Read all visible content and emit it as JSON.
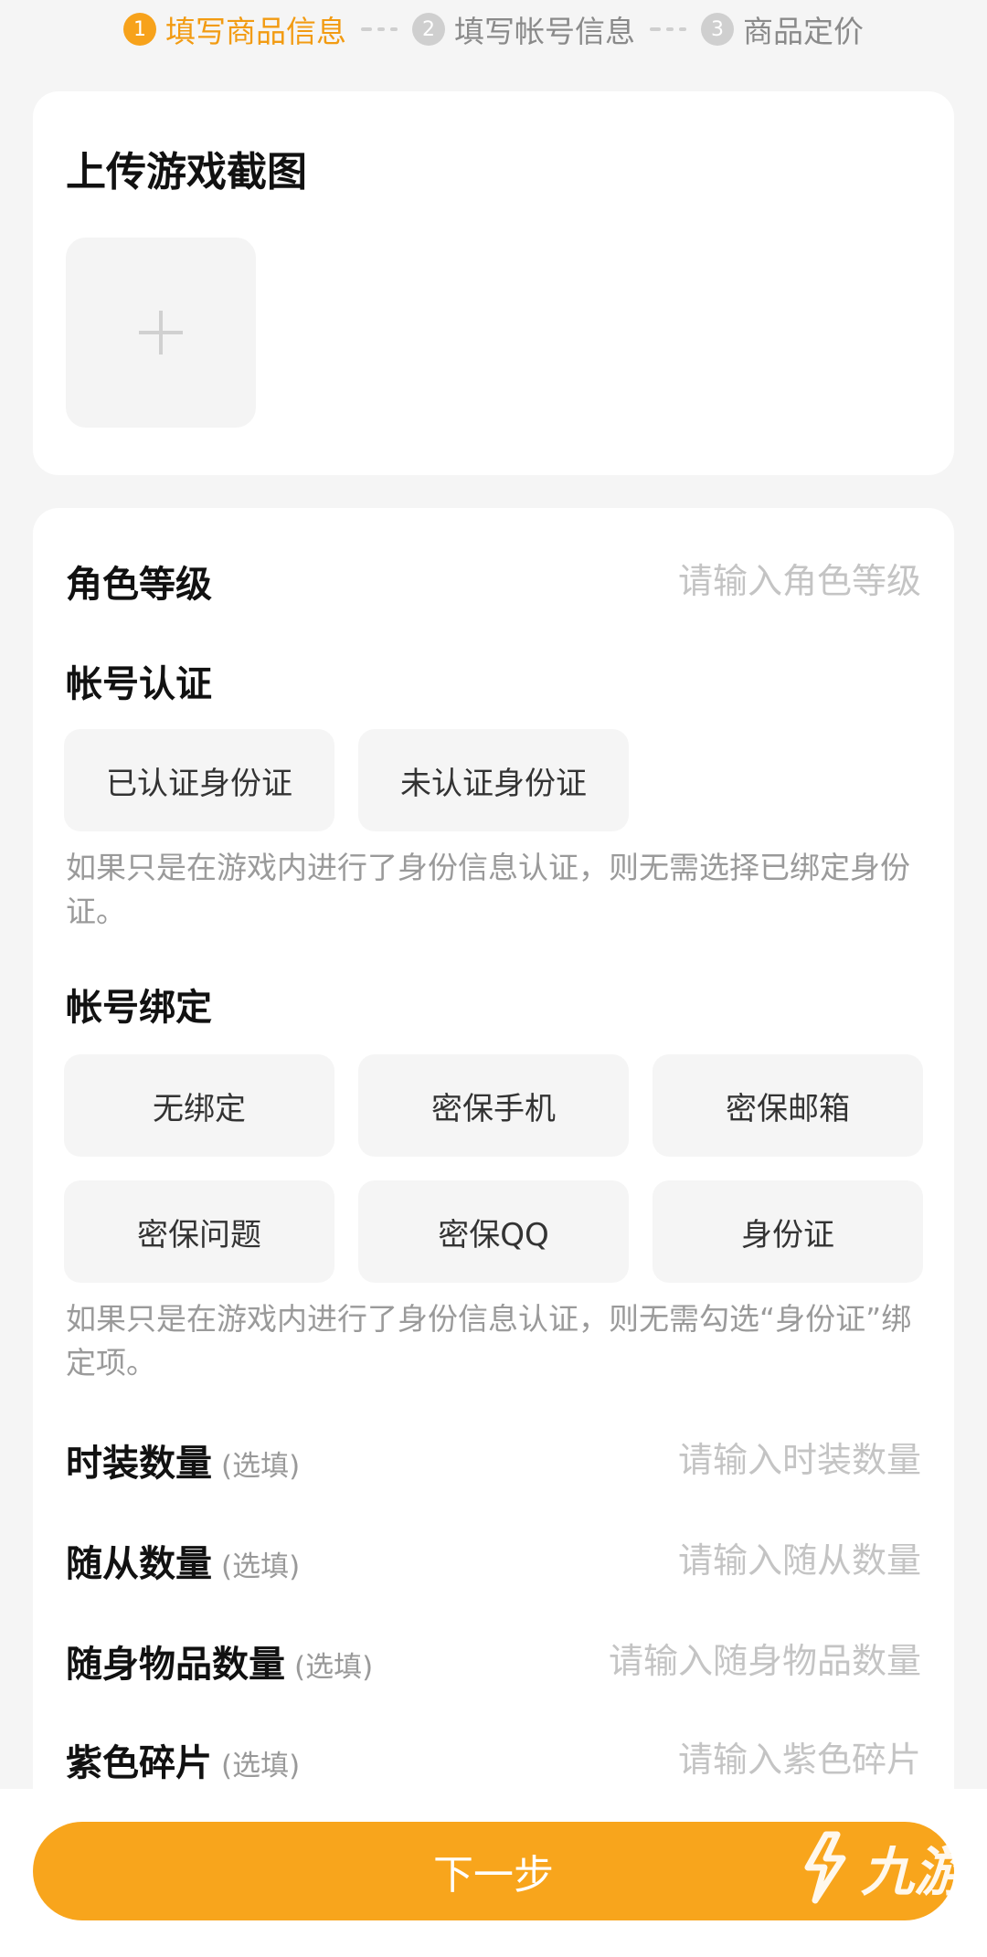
{
  "stepper": {
    "steps": [
      {
        "num": "1",
        "label": "填写商品信息"
      },
      {
        "num": "2",
        "label": "填写帐号信息"
      },
      {
        "num": "3",
        "label": "商品定价"
      }
    ]
  },
  "upload": {
    "title": "上传游戏截图",
    "add_icon": "plus-icon"
  },
  "form": {
    "level": {
      "label": "角色等级",
      "placeholder": "请输入角色等级"
    },
    "auth": {
      "label": "帐号认证",
      "options": [
        "已认证身份证",
        "未认证身份证"
      ],
      "hint": "如果只是在游戏内进行了身份信息认证，则无需选择已绑定身份证。"
    },
    "binding": {
      "label": "帐号绑定",
      "options": [
        "无绑定",
        "密保手机",
        "密保邮箱",
        "密保问题",
        "密保QQ",
        "身份证"
      ],
      "hint": "如果只是在游戏内进行了身份信息认证，则无需勾选“身份证”绑定项。"
    },
    "optional_tag": "(选填)",
    "fashion": {
      "label": "时装数量",
      "placeholder": "请输入时装数量"
    },
    "follower": {
      "label": "随从数量",
      "placeholder": "请输入随从数量"
    },
    "items": {
      "label": "随身物品数量",
      "placeholder": "请输入随身物品数量"
    },
    "purple": {
      "label": "紫色碎片",
      "placeholder": "请输入紫色碎片"
    }
  },
  "footer": {
    "next_label": "下一步",
    "watermark": "九游"
  },
  "colors": {
    "accent": "#f8a51c",
    "background": "#f5f5f5"
  }
}
